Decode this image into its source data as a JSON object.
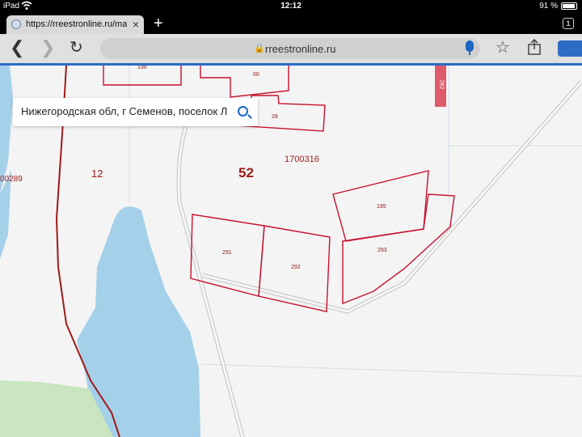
{
  "status_bar": {
    "device": "iPad",
    "time": "12:12",
    "battery_text": "91 %",
    "battery_level": 0.91
  },
  "browser": {
    "tab_title": "https://rreestronline.ru/map",
    "tab_count": "1",
    "url_domain": "rreestronline.ru"
  },
  "map": {
    "search_value": "Нижегородская обл, г Семенов, поселок Лещево",
    "labels": {
      "parcel_196": "196",
      "parcel_60": "60",
      "parcel_262": "262",
      "parcel_28": "28",
      "block_1700316": "1700316",
      "region_52": "52",
      "block_12": "12",
      "block_00289": "00289",
      "parcel_195": "195",
      "parcel_293": "293",
      "parcel_291": "291",
      "parcel_292": "292"
    }
  },
  "colors": {
    "accent": "#2c6ac8",
    "water": "#a5d0ea",
    "parcel": "#c8102e",
    "forest": "#c9e6c0"
  }
}
